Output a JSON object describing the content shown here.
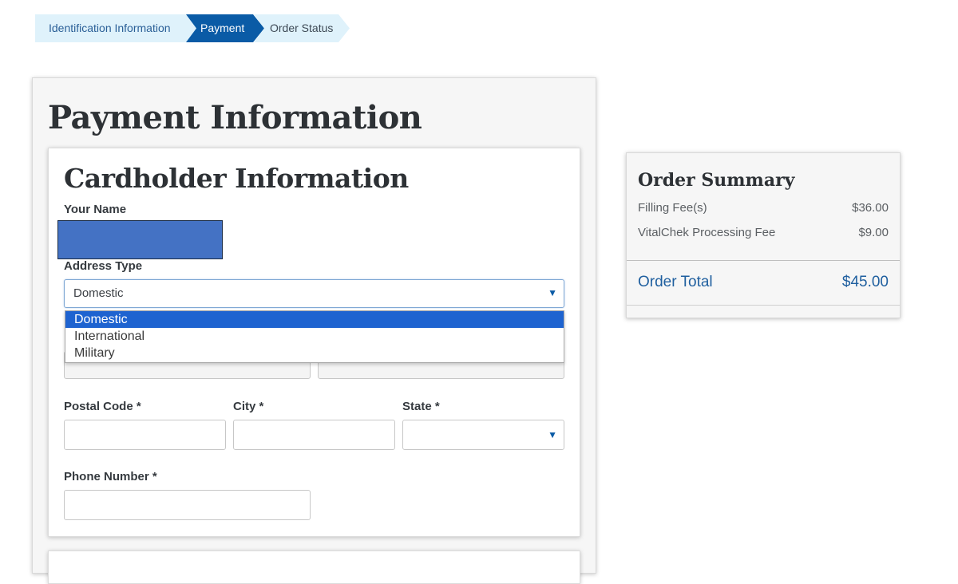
{
  "breadcrumb": {
    "steps": [
      {
        "label": "Identification Information",
        "state": "complete"
      },
      {
        "label": "Payment",
        "state": "active"
      },
      {
        "label": "Order Status",
        "state": "upcoming"
      }
    ]
  },
  "page": {
    "title": "Payment Information"
  },
  "cardholder": {
    "title": "Cardholder Information",
    "name_label": "Your Name",
    "address_type_label": "Address Type",
    "address_type_value": "Domestic",
    "address_type_options": [
      "Domestic",
      "International",
      "Military"
    ],
    "postal_code_label": "Postal Code *",
    "city_label": "City *",
    "state_label": "State *",
    "phone_label": "Phone Number *"
  },
  "summary": {
    "title": "Order Summary",
    "items": [
      {
        "label": "Filling Fee(s)",
        "amount": "$36.00"
      },
      {
        "label": "VitalChek Processing Fee",
        "amount": "$9.00"
      }
    ],
    "total_label": "Order Total",
    "total_amount": "$45.00"
  },
  "icons": {
    "dropdown_caret": "caret-down-icon"
  },
  "colors": {
    "accent": "#0a5ba6",
    "step_inactive": "#dff2fb",
    "option_highlight": "#1e63d0",
    "redaction": "#4472c4"
  }
}
